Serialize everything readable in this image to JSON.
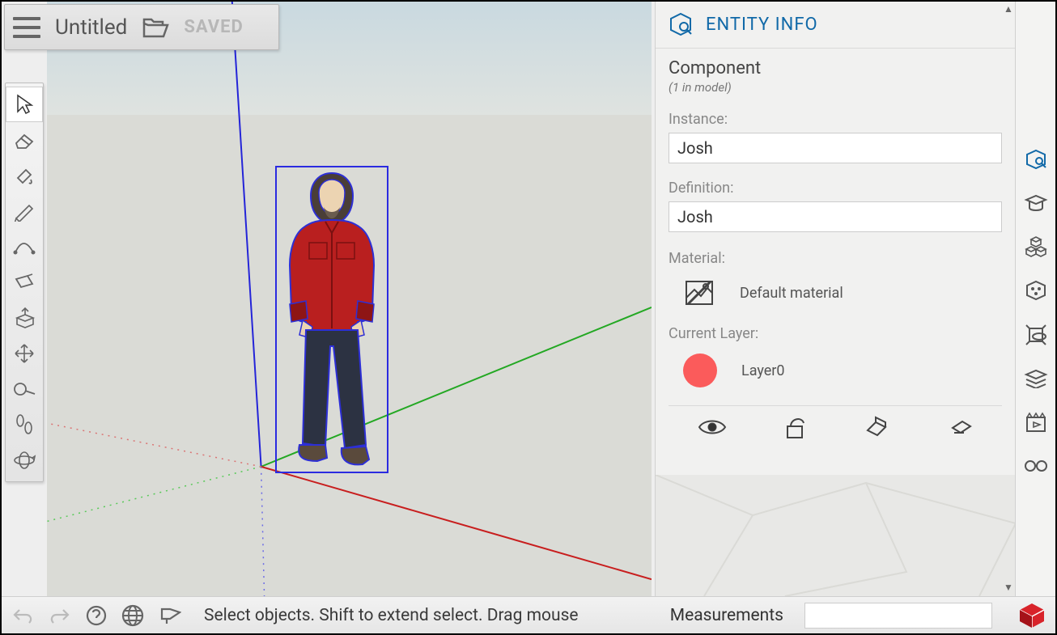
{
  "header": {
    "docTitle": "Untitled",
    "savedLabel": "SAVED"
  },
  "panel": {
    "title": "ENTITY INFO",
    "typeTitle": "Component",
    "typeSub": "(1 in model)",
    "instanceLabel": "Instance:",
    "instanceValue": "Josh",
    "definitionLabel": "Definition:",
    "definitionValue": "Josh",
    "materialLabel": "Material:",
    "materialName": "Default material",
    "layerLabel": "Current Layer:",
    "layerName": "Layer0",
    "layerColor": "#fb5b5b"
  },
  "status": {
    "hint": "Select objects. Shift to extend select. Drag mouse",
    "measurementsLabel": "Measurements",
    "measurementsValue": ""
  },
  "tools": [
    {
      "name": "select-tool",
      "active": true
    },
    {
      "name": "eraser-tool",
      "active": false
    },
    {
      "name": "paint-tool",
      "active": false
    },
    {
      "name": "pencil-tool",
      "active": false
    },
    {
      "name": "arc-tool",
      "active": false
    },
    {
      "name": "rectangle-tool",
      "active": false
    },
    {
      "name": "pushpull-tool",
      "active": false
    },
    {
      "name": "move-tool",
      "active": false
    },
    {
      "name": "tape-measure-tool",
      "active": false
    },
    {
      "name": "walk-tool",
      "active": false
    },
    {
      "name": "orbit-tool",
      "active": false
    }
  ],
  "rail": [
    {
      "name": "entity-info-tab",
      "active": true
    },
    {
      "name": "instructor-tab",
      "active": false
    },
    {
      "name": "components-tab",
      "active": false
    },
    {
      "name": "materials-tab",
      "active": false
    },
    {
      "name": "styles-tab",
      "active": false
    },
    {
      "name": "layers-tab",
      "active": false
    },
    {
      "name": "scenes-tab",
      "active": false
    },
    {
      "name": "display-tab",
      "active": false
    }
  ]
}
